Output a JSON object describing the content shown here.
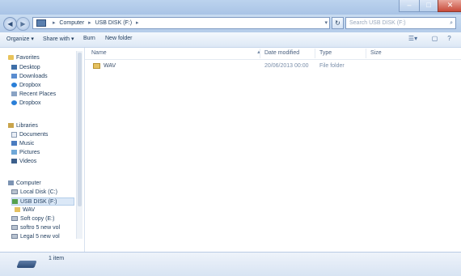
{
  "window": {
    "caption_min": "–",
    "caption_max": "□",
    "caption_close": "✕"
  },
  "address": {
    "back": "◀",
    "forward": "▶",
    "segments": [
      "Computer",
      "USB DISK (F:)"
    ],
    "tail": "▾",
    "refresh": "↻",
    "search_placeholder": "Search USB DISK (F:)"
  },
  "toolbar": {
    "organize": "Organize ▾",
    "share": "Share with ▾",
    "burn": "Burn",
    "new_folder": "New folder",
    "views": "☰▾",
    "preview": "▢",
    "help": "?"
  },
  "nav": {
    "favorites": "Favorites",
    "desktop": "Desktop",
    "downloads": "Downloads",
    "dropbox": "Dropbox",
    "recent_places": "Recent Places",
    "dropbox2": "Dropbox",
    "libraries": "Libraries",
    "documents": "Documents",
    "music": "Music",
    "pictures": "Pictures",
    "videos": "Videos",
    "computer": "Computer",
    "local_disk": "Local Disk (C:)",
    "usb_disk": "USB DISK (F:)",
    "usb_folder": "WAV",
    "item1": "Soft copy (E:)",
    "item2": "softro 5 new vol",
    "item3": "Legal 5 new vol"
  },
  "columns": {
    "name": "Name",
    "date": "Date modified",
    "type": "Type",
    "size": "Size",
    "sort": "▲"
  },
  "files": [
    {
      "name": "WAV",
      "date": "20/06/2013 00:00",
      "type": "File folder",
      "size": ""
    }
  ],
  "status": {
    "text": "1 item"
  }
}
